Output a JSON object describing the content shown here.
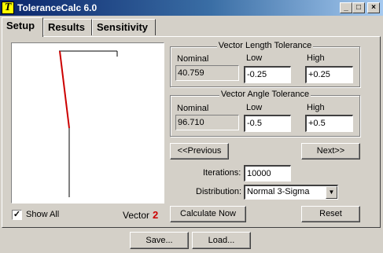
{
  "window": {
    "title": "ToleranceCalc 6.0",
    "icon_letter": "T",
    "min_glyph": "_",
    "max_glyph": "□",
    "close_glyph": "×"
  },
  "tabs": [
    {
      "label": "Setup",
      "active": true
    },
    {
      "label": "Results",
      "active": false
    },
    {
      "label": "Sensitivity",
      "active": false
    }
  ],
  "vector_length": {
    "title": "Vector Length Tolerance",
    "nominal_label": "Nominal",
    "low_label": "Low",
    "high_label": "High",
    "nominal": "40.759",
    "low": "-0.25",
    "high": "+0.25"
  },
  "vector_angle": {
    "title": "Vector Angle Tolerance",
    "nominal_label": "Nominal",
    "low_label": "Low",
    "high_label": "High",
    "nominal": "96.710",
    "low": "-0.5",
    "high": "+0.5"
  },
  "nav": {
    "previous": "<<Previous",
    "next": "Next>>"
  },
  "iterations": {
    "label": "Iterations:",
    "value": "10000"
  },
  "distribution": {
    "label": "Distribution:",
    "value": "Normal 3-Sigma"
  },
  "show_all": {
    "label": "Show All",
    "checked": true,
    "check_glyph": "✓"
  },
  "vector": {
    "label": "Vector",
    "number": "2",
    "number_color": "#cc0000"
  },
  "actions": {
    "calculate": "Calculate Now",
    "reset": "Reset"
  },
  "footer": {
    "save": "Save...",
    "load": "Load..."
  },
  "colors": {
    "titlebar_start": "#0a246a",
    "face": "#d4d0c8",
    "highlight_vector": "#cc0000"
  }
}
